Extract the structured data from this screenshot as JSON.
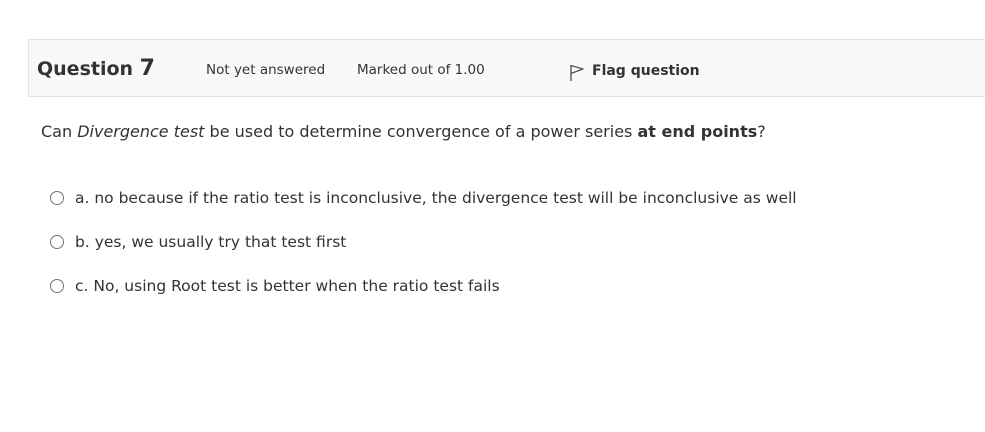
{
  "question": {
    "title_prefix": "Question ",
    "number": "7",
    "state": "Not yet answered",
    "grade": "Marked out of 1.00",
    "flag_label": "Flag question",
    "flag_icon": "flag-icon",
    "text": {
      "part1": "Can ",
      "emphasis": "Divergence test",
      "part2": " be used to determine convergence of a power series ",
      "strong": "at end points",
      "part3": "?"
    },
    "answers": [
      {
        "label": "a. no because if the ratio test is inconclusive, the divergence test will be inconclusive as well"
      },
      {
        "label": "b. yes, we usually try that test first"
      },
      {
        "label": "c. No, using Root test is better when the ratio test fails"
      }
    ]
  }
}
